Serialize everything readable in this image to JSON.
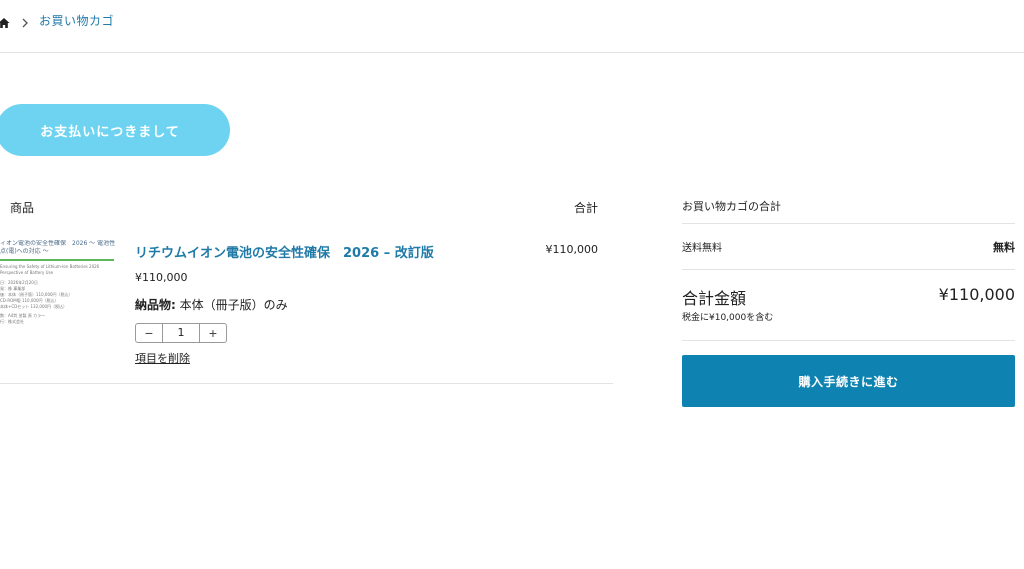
{
  "breadcrumb": {
    "home_icon": "home-icon",
    "separator_icon": "chevron-right-icon",
    "current": "お買い物カゴ"
  },
  "actions": {
    "pay_info": "お支払いにつきまして"
  },
  "cart": {
    "header_product": "商品",
    "header_total": "合計",
    "items": [
      {
        "thumbnail": {
          "title": "ィオン電池の安全性確保　2026 〜 電池性",
          "subtitle": "点(電)への対応 〜",
          "en": "Ensuring the Safety of Lithium-Ion Batteries 2026",
          "en2": "Perspective of Battery Use",
          "lines": [
            "日：2026年2月20日",
            "発：株 事業部",
            "価：本体（冊子版）110,000円（税込）",
            "CD-ROM版 110,000円（税込）",
            "本体+CDセット 132,000円（税込）",
            "数：A4判 並製 頁 カラー",
            "行：株式会社"
          ]
        },
        "name": "リチウムイオン電池の安全性確保　2026 – 改訂版",
        "price": "¥110,000",
        "delivery_label": "納品物:",
        "delivery_value": "本体（冊子版）のみ",
        "quantity": "1",
        "minus": "−",
        "plus": "+",
        "remove": "項目を削除",
        "total": "¥110,000"
      }
    ]
  },
  "summary": {
    "title": "お買い物カゴの合計",
    "shipping_label": "送料無料",
    "shipping_value": "無料",
    "total_label": "合計金額",
    "total_value": "¥110,000",
    "tax_note": "税金に¥10,000を含む",
    "checkout": "購入手続きに進む"
  },
  "colors": {
    "accent": "#1f7aa8",
    "pay_button": "#6dd3f1",
    "checkout_button": "#0e83b1"
  }
}
